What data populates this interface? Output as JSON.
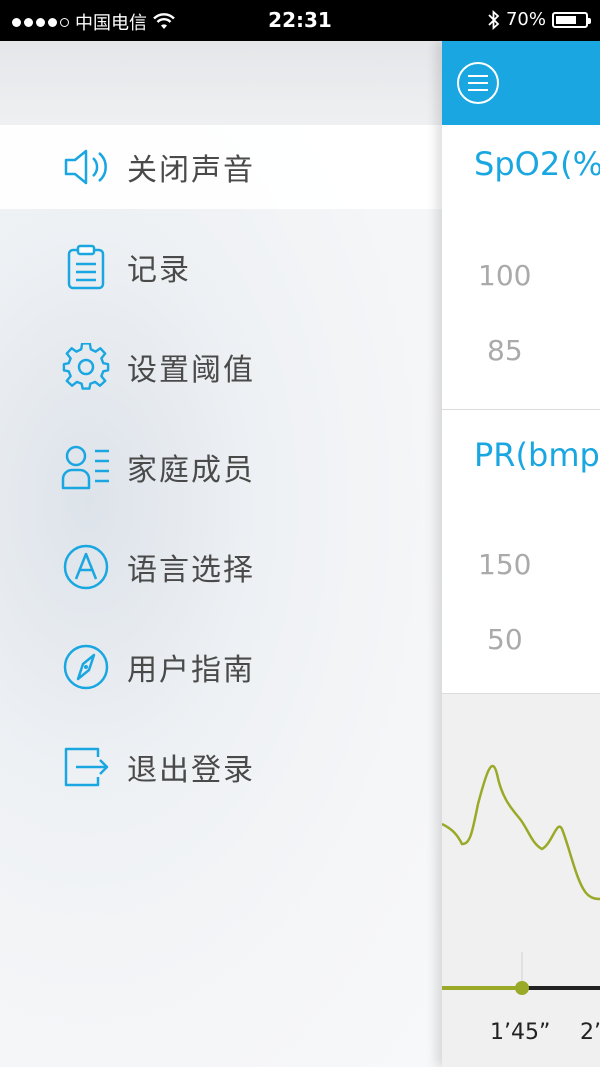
{
  "status_bar": {
    "carrier": "中国电信",
    "time": "22:31",
    "battery": "70%",
    "battery_level": 0.7
  },
  "drawer": {
    "items": [
      {
        "label": "关闭声音",
        "icon": "speaker-icon",
        "active": true
      },
      {
        "label": "记录",
        "icon": "clipboard-icon",
        "active": false
      },
      {
        "label": "设置阈值",
        "icon": "gear-icon",
        "active": false
      },
      {
        "label": "家庭成员",
        "icon": "family-members-icon",
        "active": false
      },
      {
        "label": "语言选择",
        "icon": "language-icon",
        "active": false
      },
      {
        "label": "用户指南",
        "icon": "compass-icon",
        "active": false
      },
      {
        "label": "退出登录",
        "icon": "logout-icon",
        "active": false
      }
    ]
  },
  "main": {
    "spo2_card": {
      "title": "SpO2(%",
      "upper": "100",
      "lower": "85"
    },
    "pr_card": {
      "title": "PR(bmp",
      "upper": "150",
      "lower": "50"
    },
    "timeline": {
      "ticks": [
        "1’45”",
        "2’"
      ]
    }
  },
  "colors": {
    "accent": "#1aa7e1",
    "wave": "#9aaa28",
    "progress": "#9aaa28"
  }
}
